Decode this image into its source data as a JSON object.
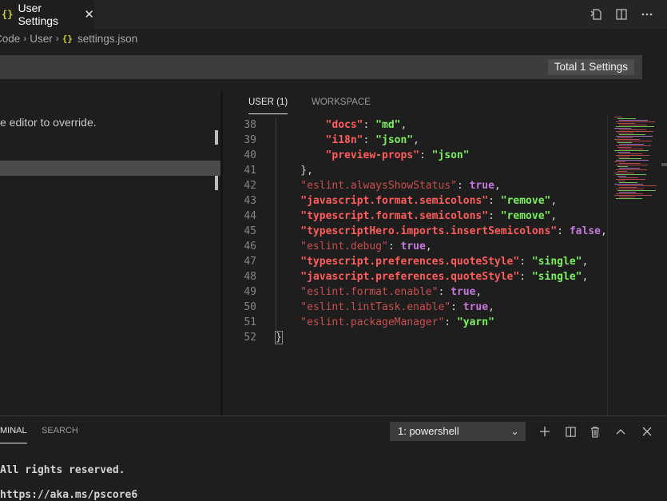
{
  "tab": {
    "icon": "json-braces-icon",
    "braces": "{}",
    "title": "User Settings",
    "close": "✕"
  },
  "top_actions": [
    "open-settings-json-icon",
    "split-editor-icon",
    "more-actions-icon"
  ],
  "breadcrumb": {
    "parts": [
      "Code",
      "User"
    ],
    "file_braces": "{}",
    "file": "settings.json"
  },
  "search": {
    "total_badge": "Total 1 Settings"
  },
  "left": {
    "hint": "e editor to override."
  },
  "settings_tabs": [
    "USER (1)",
    "WORKSPACE"
  ],
  "colors": {
    "key": "#ff6b6b",
    "string": "#7cf05c",
    "bool": "#c678dd",
    "punct": "#d4d4d4",
    "bracket_highlight": "#888888"
  },
  "editor": {
    "lines": [
      {
        "n": "38",
        "indent": 8,
        "tokens": [
          {
            "t": "\"docs\"",
            "c": "key2"
          },
          {
            "t": ": ",
            "c": "p"
          },
          {
            "t": "\"md\"",
            "c": "s"
          },
          {
            "t": ",",
            "c": "p"
          }
        ]
      },
      {
        "n": "39",
        "indent": 8,
        "tokens": [
          {
            "t": "\"i18n\"",
            "c": "key2"
          },
          {
            "t": ": ",
            "c": "p"
          },
          {
            "t": "\"json\"",
            "c": "s"
          },
          {
            "t": ",",
            "c": "p"
          }
        ]
      },
      {
        "n": "40",
        "indent": 8,
        "tokens": [
          {
            "t": "\"preview-props\"",
            "c": "key2"
          },
          {
            "t": ": ",
            "c": "p"
          },
          {
            "t": "\"json\"",
            "c": "s"
          }
        ]
      },
      {
        "n": "41",
        "indent": 4,
        "tokens": [
          {
            "t": "},",
            "c": "p"
          }
        ]
      },
      {
        "n": "42",
        "indent": 4,
        "tokens": [
          {
            "t": "\"eslint.alwaysShowStatus\"",
            "c": "k"
          },
          {
            "t": ": ",
            "c": "p"
          },
          {
            "t": "true",
            "c": "b"
          },
          {
            "t": ",",
            "c": "p"
          }
        ]
      },
      {
        "n": "43",
        "indent": 4,
        "tokens": [
          {
            "t": "\"javascript.format.semicolons\"",
            "c": "key2"
          },
          {
            "t": ": ",
            "c": "p"
          },
          {
            "t": "\"remove\"",
            "c": "s"
          },
          {
            "t": ",",
            "c": "p"
          }
        ]
      },
      {
        "n": "44",
        "indent": 4,
        "tokens": [
          {
            "t": "\"typescript.format.semicolons\"",
            "c": "key2"
          },
          {
            "t": ": ",
            "c": "p"
          },
          {
            "t": "\"remove\"",
            "c": "s"
          },
          {
            "t": ",",
            "c": "p"
          }
        ]
      },
      {
        "n": "45",
        "indent": 4,
        "tokens": [
          {
            "t": "\"typescriptHero.imports.insertSemicolons\"",
            "c": "key2"
          },
          {
            "t": ": ",
            "c": "p"
          },
          {
            "t": "false",
            "c": "b"
          },
          {
            "t": ",",
            "c": "p"
          }
        ]
      },
      {
        "n": "46",
        "indent": 4,
        "tokens": [
          {
            "t": "\"eslint.debug\"",
            "c": "k"
          },
          {
            "t": ": ",
            "c": "p"
          },
          {
            "t": "true",
            "c": "b"
          },
          {
            "t": ",",
            "c": "p"
          }
        ]
      },
      {
        "n": "47",
        "indent": 4,
        "tokens": [
          {
            "t": "\"typescript.preferences.quoteStyle\"",
            "c": "key2"
          },
          {
            "t": ": ",
            "c": "p"
          },
          {
            "t": "\"single\"",
            "c": "s"
          },
          {
            "t": ",",
            "c": "p"
          }
        ]
      },
      {
        "n": "48",
        "indent": 4,
        "tokens": [
          {
            "t": "\"javascript.preferences.quoteStyle\"",
            "c": "key2"
          },
          {
            "t": ": ",
            "c": "p"
          },
          {
            "t": "\"single\"",
            "c": "s"
          },
          {
            "t": ",",
            "c": "p"
          }
        ]
      },
      {
        "n": "49",
        "indent": 4,
        "tokens": [
          {
            "t": "\"eslint.format.enable\"",
            "c": "k"
          },
          {
            "t": ": ",
            "c": "p"
          },
          {
            "t": "true",
            "c": "b"
          },
          {
            "t": ",",
            "c": "p"
          }
        ]
      },
      {
        "n": "50",
        "indent": 4,
        "tokens": [
          {
            "t": "\"eslint.lintTask.enable\"",
            "c": "k"
          },
          {
            "t": ": ",
            "c": "p"
          },
          {
            "t": "true",
            "c": "b"
          },
          {
            "t": ",",
            "c": "p"
          }
        ]
      },
      {
        "n": "51",
        "indent": 4,
        "tokens": [
          {
            "t": "\"eslint.packageManager\"",
            "c": "k"
          },
          {
            "t": ": ",
            "c": "p"
          },
          {
            "t": "\"yarn\"",
            "c": "s"
          }
        ]
      },
      {
        "n": "52",
        "indent": 0,
        "tokens": [
          {
            "t": "}",
            "c": "hb"
          }
        ]
      }
    ]
  },
  "panel": {
    "tabs": [
      "MINAL",
      "SEARCH"
    ],
    "terminal_select": "1: powershell",
    "actions": [
      "add-terminal-icon",
      "split-terminal-icon",
      "trash-icon",
      "maximize-panel-icon",
      "close-panel-icon"
    ],
    "terminal_lines": [
      "All rights reserved.",
      "https://aka.ms/pscore6"
    ]
  }
}
